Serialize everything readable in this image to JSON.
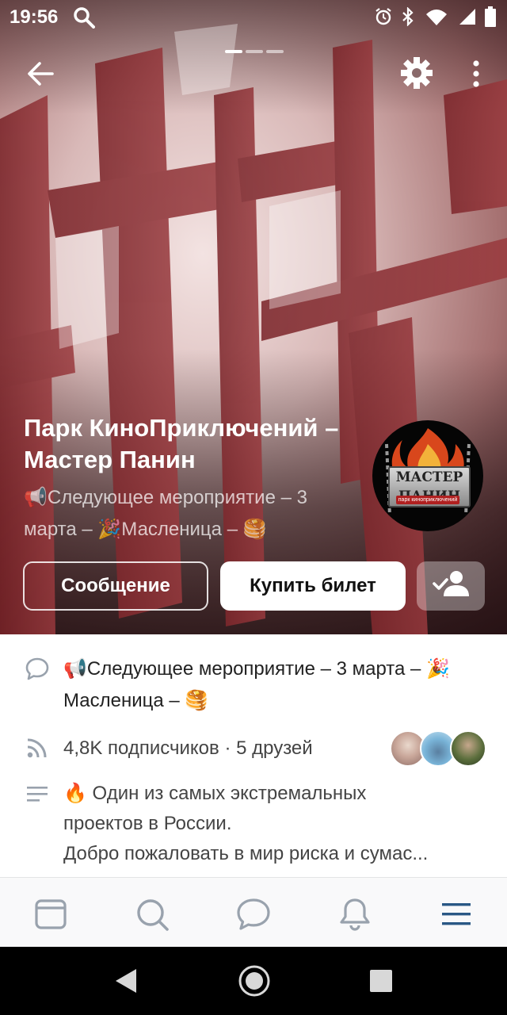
{
  "status_bar": {
    "time": "19:56"
  },
  "community": {
    "name": "Парк КиноПриключений – Мастер Панин",
    "status_text": "📢Следующее мероприятие – 3 марта – 🎉Масленица – 🥞",
    "avatar_text": "МАСТЕР ПАНИН",
    "avatar_subtext": "парк киноприключений"
  },
  "actions": {
    "message_label": "Сообщение",
    "buy_ticket_label": "Купить билет"
  },
  "info": {
    "status_full": "📢Следующее мероприятие – 3 марта – 🎉Масленица – 🥞",
    "followers": "4,8K подписчиков · 5 друзей",
    "description_line1": "🔥 Один из самых экстремальных",
    "description_line2": "проектов в  России.",
    "description_line3": "Добро пожаловать в мир риска и сумас..."
  },
  "bottom_nav": {
    "items": [
      "feed",
      "search",
      "messages",
      "notifications",
      "menu"
    ],
    "active": "menu"
  },
  "colors": {
    "accent": "#2a5885",
    "icon_gray": "#99a2ad",
    "hero_tint": "#b56a6c"
  }
}
